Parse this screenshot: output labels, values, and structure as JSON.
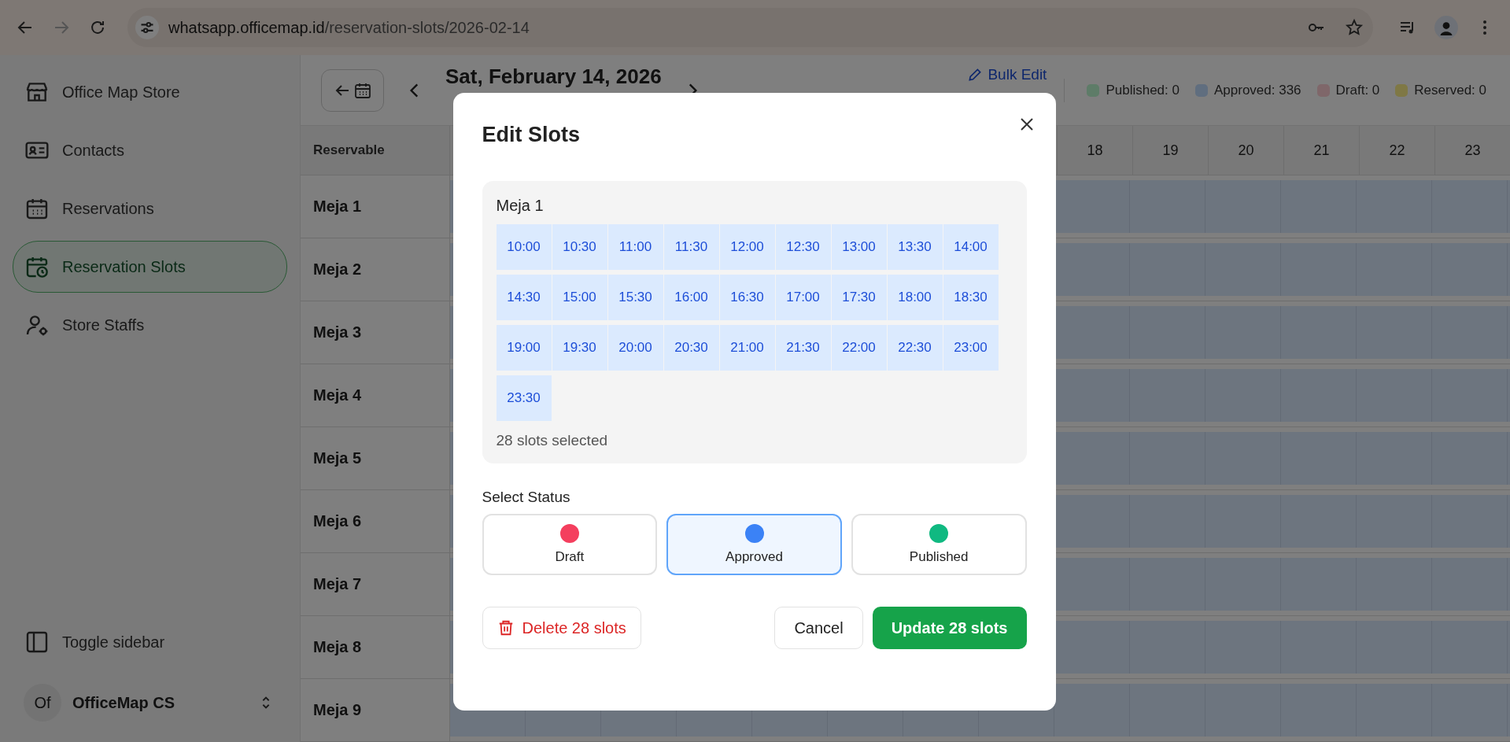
{
  "browser": {
    "url_host": "whatsapp.officemap.id",
    "url_path": "/reservation-slots/2026-02-14"
  },
  "sidebar": {
    "items": [
      {
        "label": "Office Map Store",
        "selected": false
      },
      {
        "label": "Contacts",
        "selected": false
      },
      {
        "label": "Reservations",
        "selected": false
      },
      {
        "label": "Reservation Slots",
        "selected": true
      },
      {
        "label": "Store Staffs",
        "selected": false
      }
    ],
    "toggle": "Toggle sidebar",
    "user": {
      "initials": "Of",
      "name": "OfficeMap CS"
    }
  },
  "header": {
    "date": "Sat, February 14, 2026",
    "bulk_edit": "Bulk Edit",
    "legend": [
      {
        "label": "Published: 0",
        "color": "#5e7c68"
      },
      {
        "label": "Approved: 336",
        "color": "#606e7f"
      },
      {
        "label": "Draft: 0",
        "color": "#7f676a"
      },
      {
        "label": "Reserved: 0",
        "color": "#7f7845"
      }
    ]
  },
  "table": {
    "first_column": "Reservable",
    "hours": [
      "18",
      "19",
      "20",
      "21",
      "22",
      "23"
    ],
    "rows": [
      "Meja 1",
      "Meja 2",
      "Meja 3",
      "Meja 4",
      "Meja 5",
      "Meja 6",
      "Meja 7",
      "Meja 8",
      "Meja 9"
    ]
  },
  "dialog": {
    "title": "Edit Slots",
    "table_name": "Meja 1",
    "slots": [
      {
        "time": "10:00",
        "selected": true
      },
      {
        "time": "10:30",
        "selected": true
      },
      {
        "time": "11:00",
        "selected": true
      },
      {
        "time": "11:30",
        "selected": true
      },
      {
        "time": "12:00",
        "selected": true
      },
      {
        "time": "12:30",
        "selected": true
      },
      {
        "time": "13:00",
        "selected": true
      },
      {
        "time": "13:30",
        "selected": true
      },
      {
        "time": "14:00",
        "selected": true
      },
      {
        "time": "14:30",
        "selected": true
      },
      {
        "time": "15:00",
        "selected": true
      },
      {
        "time": "15:30",
        "selected": true
      },
      {
        "time": "16:00",
        "selected": true
      },
      {
        "time": "16:30",
        "selected": true
      },
      {
        "time": "17:00",
        "selected": true
      },
      {
        "time": "17:30",
        "selected": true
      },
      {
        "time": "18:00",
        "selected": true
      },
      {
        "time": "18:30",
        "selected": true
      },
      {
        "time": "19:00",
        "selected": true
      },
      {
        "time": "19:30",
        "selected": true
      },
      {
        "time": "20:00",
        "selected": true
      },
      {
        "time": "20:30",
        "selected": true
      },
      {
        "time": "21:00",
        "selected": true
      },
      {
        "time": "21:30",
        "selected": true
      },
      {
        "time": "22:00",
        "selected": true
      },
      {
        "time": "22:30",
        "selected": true
      },
      {
        "time": "23:00",
        "selected": true
      },
      {
        "time": "23:30",
        "selected": true
      }
    ],
    "count": "28 slots selected",
    "status_label": "Select Status",
    "statuses": [
      {
        "label": "Draft",
        "color": "#f43f5e",
        "selected": false
      },
      {
        "label": "Approved",
        "color": "#3b82f6",
        "selected": true
      },
      {
        "label": "Published",
        "color": "#10b981",
        "selected": false
      }
    ],
    "delete": "Delete 28 slots",
    "cancel": "Cancel",
    "update": "Update 28 slots"
  }
}
